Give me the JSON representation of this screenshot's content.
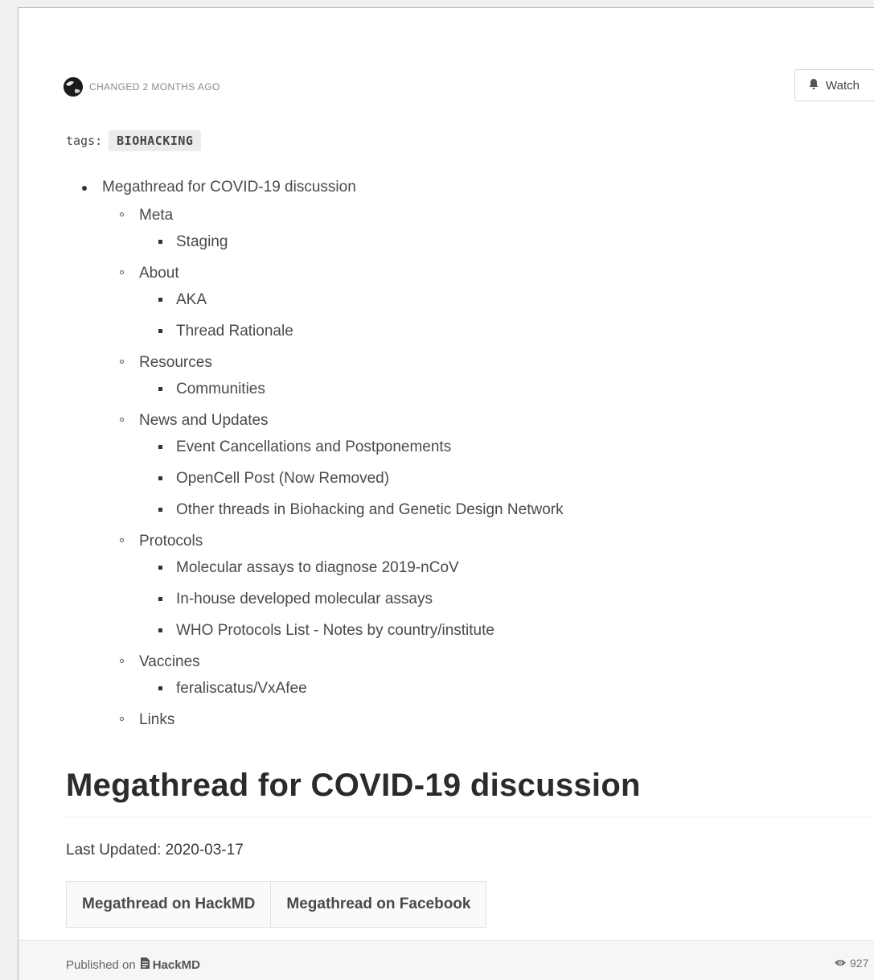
{
  "header": {
    "changed_text": "CHANGED 2 MONTHS AGO",
    "watch_label": "Watch"
  },
  "tags": {
    "label": "tags:",
    "value": "BIOHACKING"
  },
  "toc": {
    "title": "Megathread for COVID-19 discussion",
    "sections": [
      {
        "label": "Meta",
        "items": [
          "Staging"
        ]
      },
      {
        "label": "About",
        "items": [
          "AKA",
          "Thread Rationale"
        ]
      },
      {
        "label": "Resources",
        "items": [
          "Communities"
        ]
      },
      {
        "label": "News and Updates",
        "items": [
          "Event Cancellations and Postponements",
          "OpenCell Post (Now Removed)",
          "Other threads in Biohacking and Genetic Design Network"
        ]
      },
      {
        "label": "Protocols",
        "items": [
          "Molecular assays to diagnose 2019-nCoV",
          "In-house developed molecular assays",
          "WHO Protocols List - Notes by country/institute"
        ]
      },
      {
        "label": "Vaccines",
        "items": [
          "feraliscatus/VxAfee"
        ]
      },
      {
        "label": "Links",
        "items": []
      }
    ]
  },
  "main": {
    "heading": "Megathread for COVID-19 discussion",
    "last_updated": "Last Updated: 2020-03-17",
    "links": [
      "Megathread on HackMD",
      "Megathread on Facebook"
    ]
  },
  "footer": {
    "published_on": "Published on",
    "brand": "HackMD",
    "views": "927"
  },
  "icons": {
    "bell": "bell-icon",
    "eye": "eye-icon",
    "document": "document-icon"
  }
}
